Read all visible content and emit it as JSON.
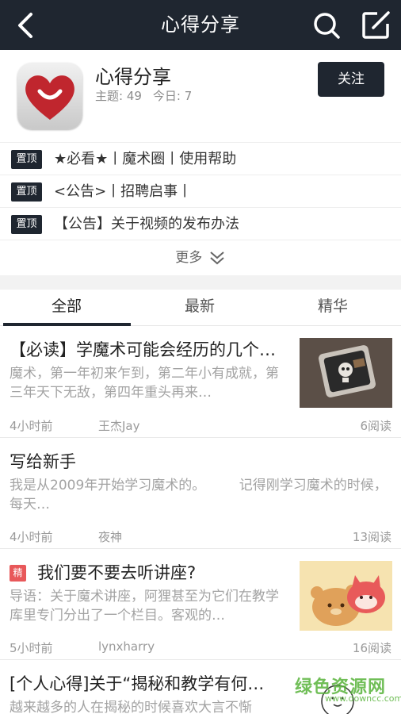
{
  "header": {
    "title": "心得分享",
    "back_icon": "chevron-left-icon",
    "search_icon": "search-icon",
    "compose_icon": "compose-icon"
  },
  "forum": {
    "name": "心得分享",
    "topics_label": "主题: 49",
    "today_label": "今日: 7",
    "follow_label": "关注"
  },
  "pinned": {
    "tag": "置顶",
    "items": [
      "★必看★丨魔术圈丨使用帮助",
      "<公告>丨招聘启事丨",
      "【公告】关于视频的发布办法"
    ],
    "more_label": "更多"
  },
  "tabs": [
    "全部",
    "最新",
    "精华"
  ],
  "posts": [
    {
      "title": "【必读】学魔术可能会经历的几个…",
      "excerpt": "魔术，第一年初来乍到，第二年小有成就，第三年天下无敌，第四年重头再来…",
      "time": "4小时前",
      "author": "王杰Jay",
      "reads": "6阅读"
    },
    {
      "title": "写给新手",
      "excerpt": "我是从2009年开始学习魔术的。　　　记得刚学习魔术的时候，每天…",
      "time": "4小时前",
      "author": "夜神",
      "reads": "13阅读"
    },
    {
      "badge": "精",
      "title": "我们要不要去听讲座?",
      "excerpt": "导语：关于魔术讲座，阿狸甚至为它们在教学库里专门分出了一个栏目。客观的…",
      "time": "5小时前",
      "author": "lynxharry",
      "reads": "16阅读"
    },
    {
      "title": "[个人心得]关于“揭秘和教学有何…",
      "excerpt": "越来越多的人在揭秘的时候喜欢大言不惭"
    }
  ],
  "watermark": {
    "line1": "绿色资源网",
    "line2": "www.downcc.com"
  },
  "colors": {
    "header_bg": "#1f2630",
    "essence_badge": "#e8585a",
    "logo_heart": "#c0262e",
    "watermark": "#58b33a"
  }
}
